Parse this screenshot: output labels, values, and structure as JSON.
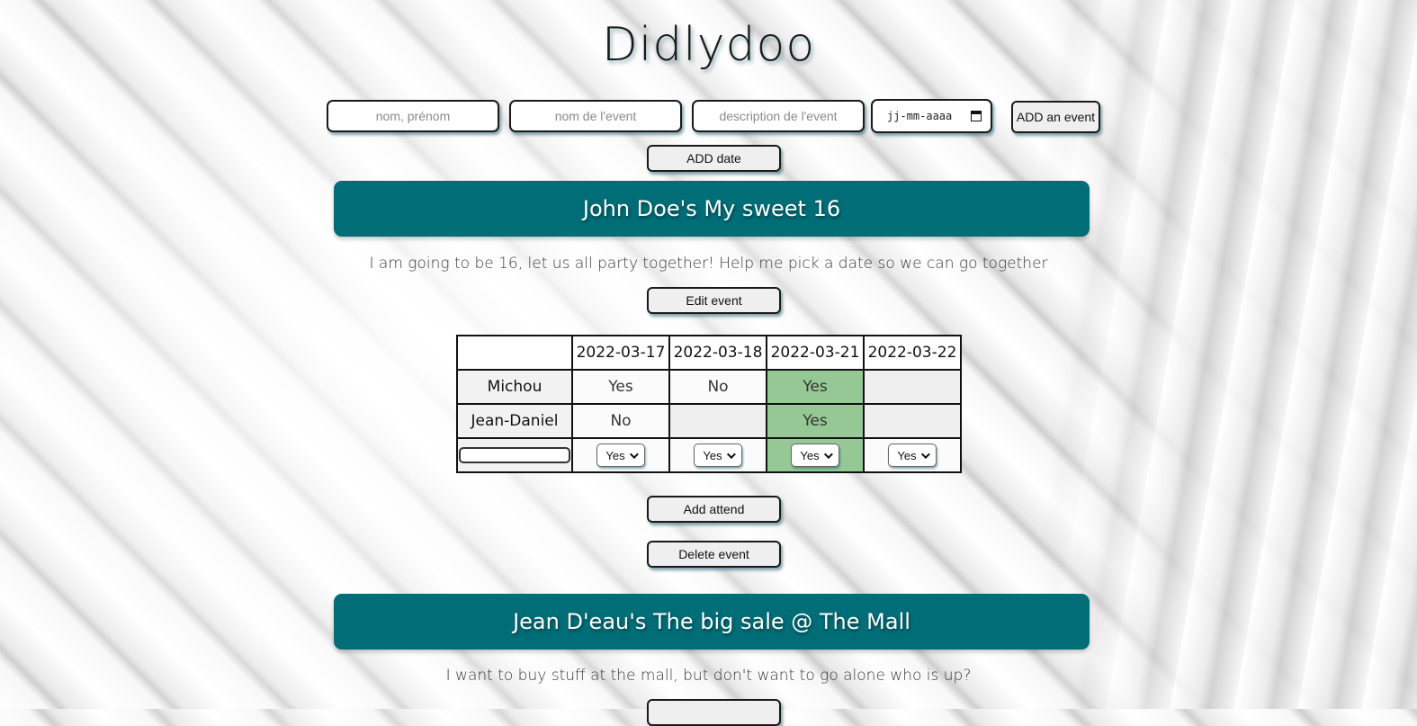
{
  "app": {
    "title": "Didlydoo"
  },
  "form": {
    "name_placeholder": "nom, prénom",
    "event_name_placeholder": "nom de l'event",
    "description_placeholder": "description de l'event",
    "date_placeholder": "jj-mm-aaaa",
    "add_event_label": "ADD an event",
    "add_date_label": "ADD date"
  },
  "events": [
    {
      "title": "John Doe's My sweet 16",
      "description": "I am going to be 16, let us all party together! Help me pick a date so we can go together",
      "edit_label": "Edit event",
      "dates": [
        "2022-03-17",
        "2022-03-18",
        "2022-03-21",
        "2022-03-22"
      ],
      "attendees": [
        {
          "name": "Michou",
          "answers": [
            "Yes",
            "No",
            "Yes",
            ""
          ]
        },
        {
          "name": "Jean-Daniel",
          "answers": [
            "No",
            "",
            "Yes",
            ""
          ]
        }
      ],
      "select_values": [
        "Yes",
        "Yes",
        "Yes",
        "Yes"
      ],
      "best_date": "2022-03-21",
      "add_attend_label": "Add attend",
      "delete_label": "Delete event"
    },
    {
      "title": "Jean D'eau's The big sale @ The Mall",
      "description": "I want to buy stuff at the mall, but don't want to go alone who is up?"
    }
  ],
  "colors": {
    "banner": "#006d77",
    "best_date_highlight": "#96c896"
  }
}
